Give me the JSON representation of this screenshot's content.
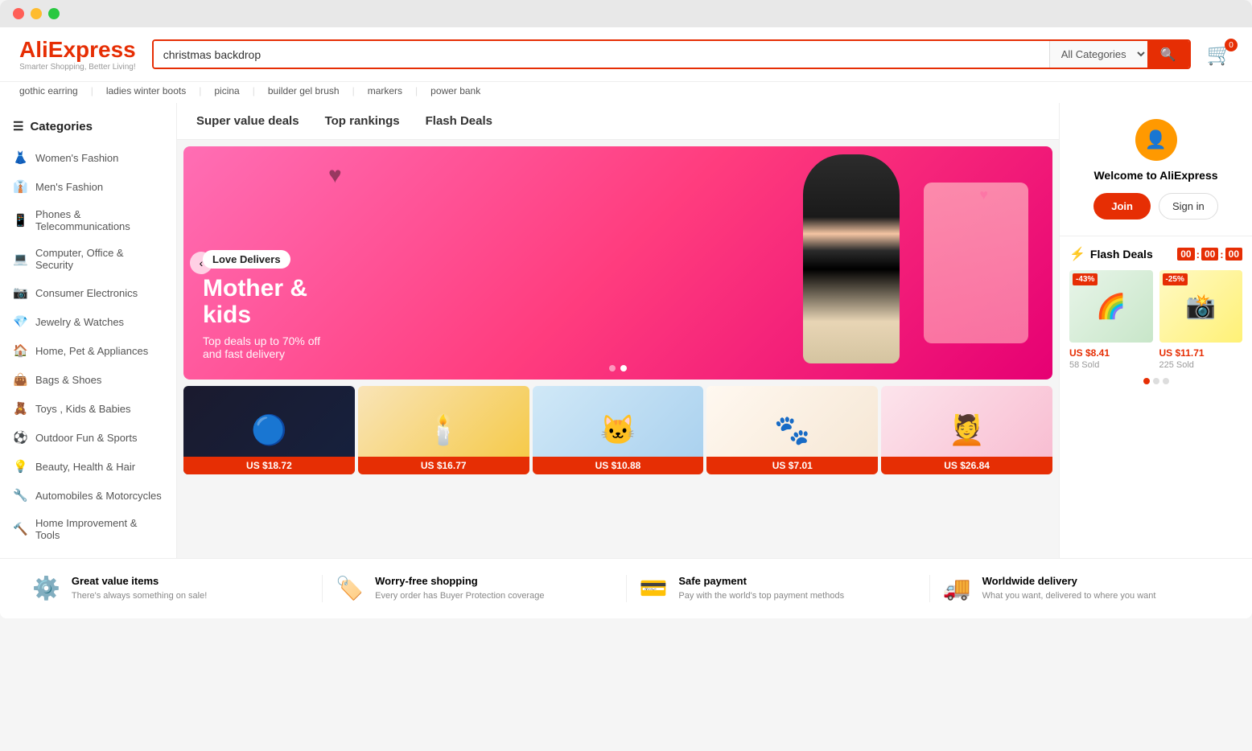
{
  "window": {
    "dots": [
      "red",
      "yellow",
      "green"
    ]
  },
  "header": {
    "logo_text": "AliExpress",
    "logo_tagline": "Smarter Shopping, Better Living!",
    "search_value": "christmas backdrop",
    "search_placeholder": "christmas backdrop",
    "category_label": "All Categories",
    "search_btn_icon": "🔍",
    "cart_count": "0"
  },
  "suggestions": [
    "gothic earring",
    "ladies winter boots",
    "picina",
    "builder gel brush",
    "markers",
    "power bank"
  ],
  "sidebar": {
    "header_label": "Categories",
    "items": [
      {
        "id": "womens-fashion",
        "icon": "👗",
        "label": "Women's Fashion"
      },
      {
        "id": "mens-fashion",
        "icon": "👔",
        "label": "Men's Fashion"
      },
      {
        "id": "phones-telecom",
        "icon": "📱",
        "label": "Phones & Telecommunications"
      },
      {
        "id": "computer-office",
        "icon": "💻",
        "label": "Computer, Office & Security"
      },
      {
        "id": "consumer-electronics",
        "icon": "📷",
        "label": "Consumer Electronics"
      },
      {
        "id": "jewelry-watches",
        "icon": "💎",
        "label": "Jewelry & Watches"
      },
      {
        "id": "home-pet-appliances",
        "icon": "🏠",
        "label": "Home, Pet & Appliances"
      },
      {
        "id": "bags-shoes",
        "icon": "👜",
        "label": "Bags & Shoes"
      },
      {
        "id": "toys-kids",
        "icon": "🧸",
        "label": "Toys , Kids & Babies"
      },
      {
        "id": "outdoor-sports",
        "icon": "⚽",
        "label": "Outdoor Fun & Sports"
      },
      {
        "id": "beauty-health",
        "icon": "💡",
        "label": "Beauty, Health & Hair"
      },
      {
        "id": "automobiles",
        "icon": "🔧",
        "label": "Automobiles & Motorcycles"
      },
      {
        "id": "home-improvement",
        "icon": "🔨",
        "label": "Home Improvement & Tools"
      }
    ]
  },
  "nav_tabs": [
    {
      "id": "super-value",
      "label": "Super value deals"
    },
    {
      "id": "top-rankings",
      "label": "Top rankings"
    },
    {
      "id": "flash-deals",
      "label": "Flash Deals"
    }
  ],
  "banner": {
    "pill": "Love Delivers",
    "title": "Mother &\nkids",
    "subtitle": "Top deals up to 70% off\nand fast delivery",
    "dots": [
      false,
      true
    ]
  },
  "products": [
    {
      "id": "p1",
      "price": "US $18.72",
      "emoji": "🔵"
    },
    {
      "id": "p2",
      "price": "US $16.77",
      "emoji": "🕯️"
    },
    {
      "id": "p3",
      "price": "US $10.88",
      "emoji": "🐱"
    },
    {
      "id": "p4",
      "price": "US $7.01",
      "emoji": "🐾"
    },
    {
      "id": "p5",
      "price": "US $26.84",
      "emoji": "💆"
    }
  ],
  "welcome": {
    "title": "Welcome to AliExpress",
    "join_label": "Join",
    "signin_label": "Sign in"
  },
  "flash_deals": {
    "title": "Flash Deals",
    "timer": {
      "hours": "00",
      "minutes": "00",
      "seconds": "00"
    },
    "items": [
      {
        "id": "fd1",
        "discount": "-43%",
        "price": "US $8.41",
        "sold": "58 Sold",
        "badge_color": "#e62e04"
      },
      {
        "id": "fd2",
        "discount": "-25%",
        "price": "US $11.71",
        "sold": "225 Sold",
        "badge_color": "#e62e04"
      }
    ],
    "dots": [
      true,
      false,
      false
    ]
  },
  "footer_features": [
    {
      "id": "great-value",
      "icon": "⚙️",
      "title": "Great value items",
      "desc": "There's always something on sale!"
    },
    {
      "id": "worry-free",
      "icon": "🏷️",
      "title": "Worry-free shopping",
      "desc": "Every order has Buyer Protection coverage"
    },
    {
      "id": "safe-payment",
      "icon": "💳",
      "title": "Safe payment",
      "desc": "Pay with the world's top payment methods"
    },
    {
      "id": "worldwide-delivery",
      "icon": "🚚",
      "title": "Worldwide delivery",
      "desc": "What you want, delivered to where you want"
    }
  ]
}
